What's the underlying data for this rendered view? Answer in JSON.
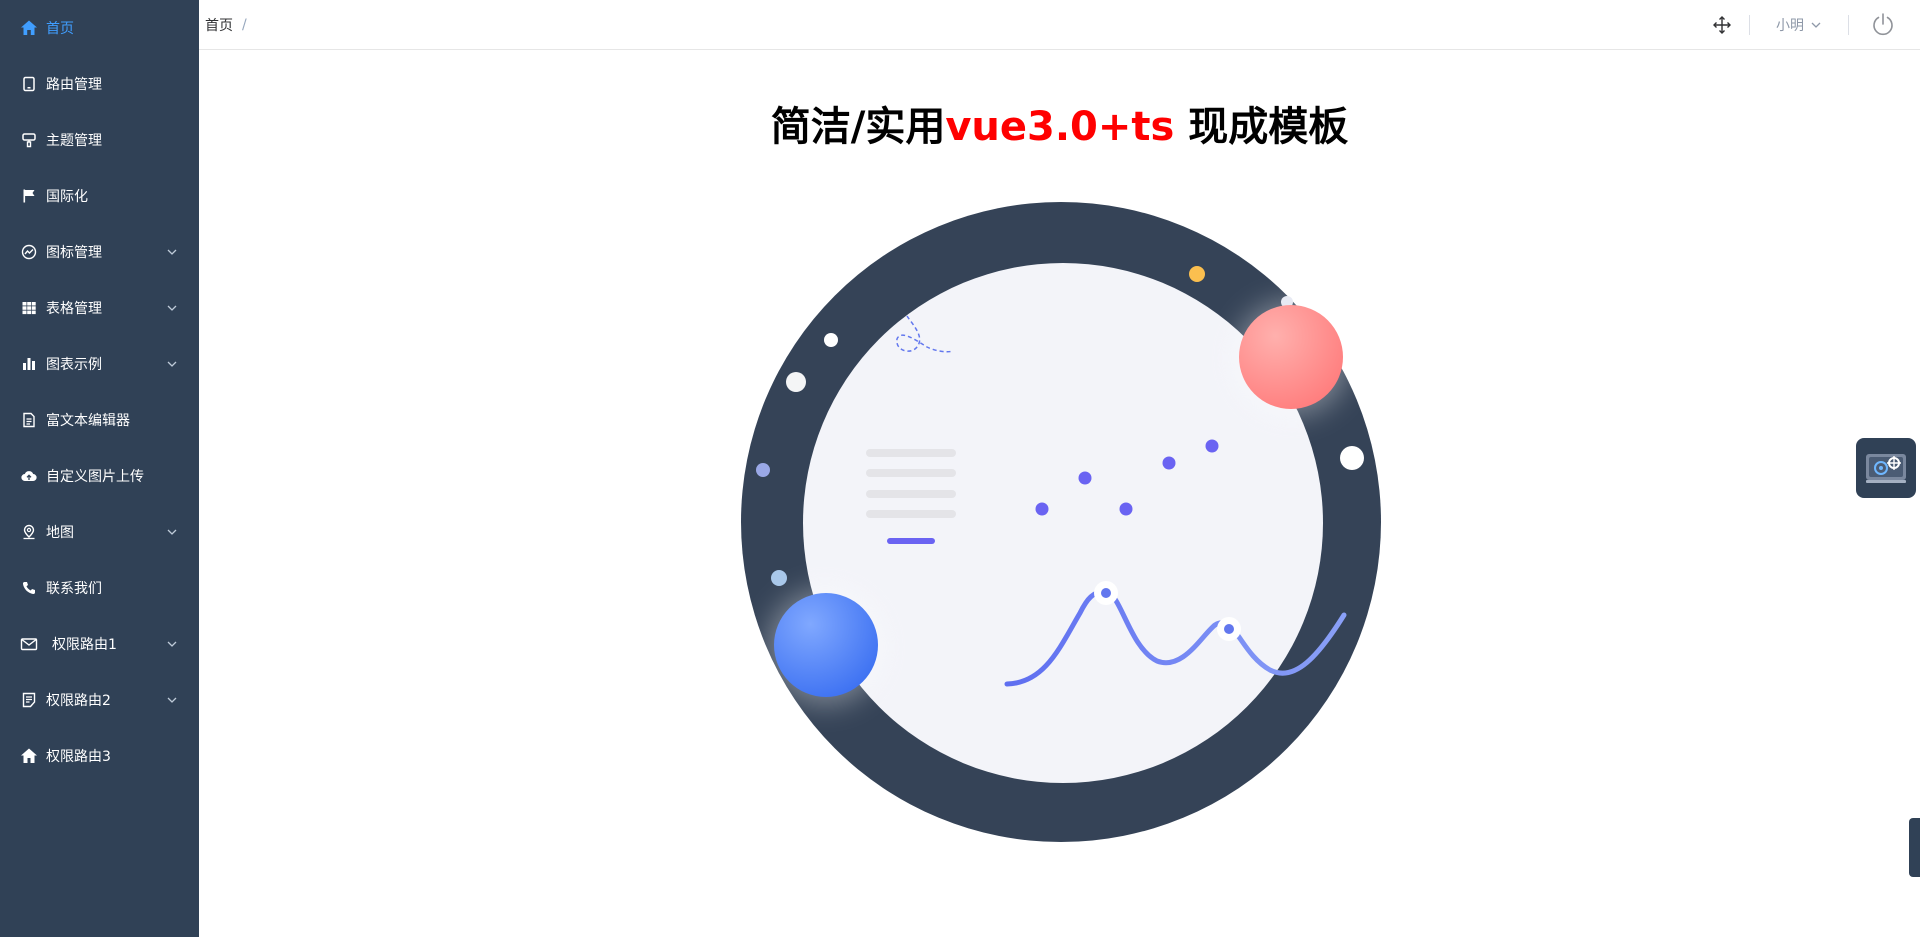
{
  "sidebar": {
    "items": [
      {
        "label": "首页",
        "icon": "home-icon",
        "active": true
      },
      {
        "label": "路由管理",
        "icon": "tablet-icon"
      },
      {
        "label": "主题管理",
        "icon": "brush-icon"
      },
      {
        "label": "国际化",
        "icon": "flag-icon"
      },
      {
        "label": "图标管理",
        "icon": "chart-line-icon",
        "expandable": true
      },
      {
        "label": "表格管理",
        "icon": "grid-icon",
        "expandable": true
      },
      {
        "label": "图表示例",
        "icon": "bar-chart-icon",
        "expandable": true
      },
      {
        "label": "富文本编辑器",
        "icon": "document-icon"
      },
      {
        "label": "自定义图片上传",
        "icon": "cloud-upload-icon"
      },
      {
        "label": "地图",
        "icon": "location-icon",
        "expandable": true
      },
      {
        "label": "联系我们",
        "icon": "phone-icon"
      },
      {
        "label": "权限路由1",
        "icon": "mail-icon",
        "expandable": true
      },
      {
        "label": "权限路由2",
        "icon": "notebook-icon",
        "expandable": true
      },
      {
        "label": "权限路由3",
        "icon": "house-icon"
      }
    ]
  },
  "header": {
    "breadcrumb": {
      "current": "首页",
      "separator": "/"
    },
    "user_name": "小明",
    "icons": [
      "move-icon",
      "chevron-down-icon",
      "power-icon"
    ]
  },
  "main": {
    "title_prefix": "简洁/实用",
    "title_accent": "vue3.0+ts",
    "title_suffix": " 现成模板"
  },
  "colors": {
    "sidebar_bg": "#304156",
    "active": "#409eff",
    "accent_red": "#ff0000",
    "ring": "#354357",
    "inner": "#f3f4f9",
    "wave": "#6b82f0",
    "dot": "#6a63f2"
  }
}
